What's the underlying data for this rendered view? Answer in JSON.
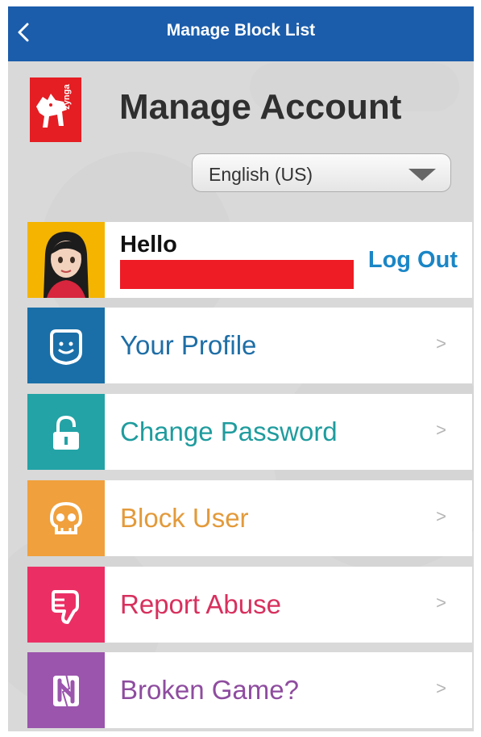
{
  "header": {
    "title": "Manage Block List",
    "back_icon": "chevron-left-icon"
  },
  "account": {
    "logo_text": "zynga",
    "title": "Manage Account",
    "language": "English (US)"
  },
  "user": {
    "greeting": "Hello",
    "logout_label": "Log Out"
  },
  "menu": [
    {
      "label": "Your Profile",
      "icon": "face-icon",
      "color": "#1a6fa8",
      "text_color": "#1e6ea6",
      "chevron": ">"
    },
    {
      "label": "Change Password",
      "icon": "lock-icon",
      "color": "#23a3a6",
      "text_color": "#1f9c9e",
      "chevron": ">"
    },
    {
      "label": "Block User",
      "icon": "skull-icon",
      "color": "#f0a03c",
      "text_color": "#e39a3a",
      "chevron": ">"
    },
    {
      "label": "Report Abuse",
      "icon": "thumbs-down-icon",
      "color": "#eb2f64",
      "text_color": "#d8305e",
      "chevron": ">"
    },
    {
      "label": "Broken Game?",
      "icon": "broken-game-icon",
      "color": "#9b55ad",
      "text_color": "#8e4c9f",
      "chevron": ">"
    }
  ],
  "colors": {
    "header": "#1b5dab",
    "brand": "#e41e23",
    "link": "#1a86c6"
  }
}
